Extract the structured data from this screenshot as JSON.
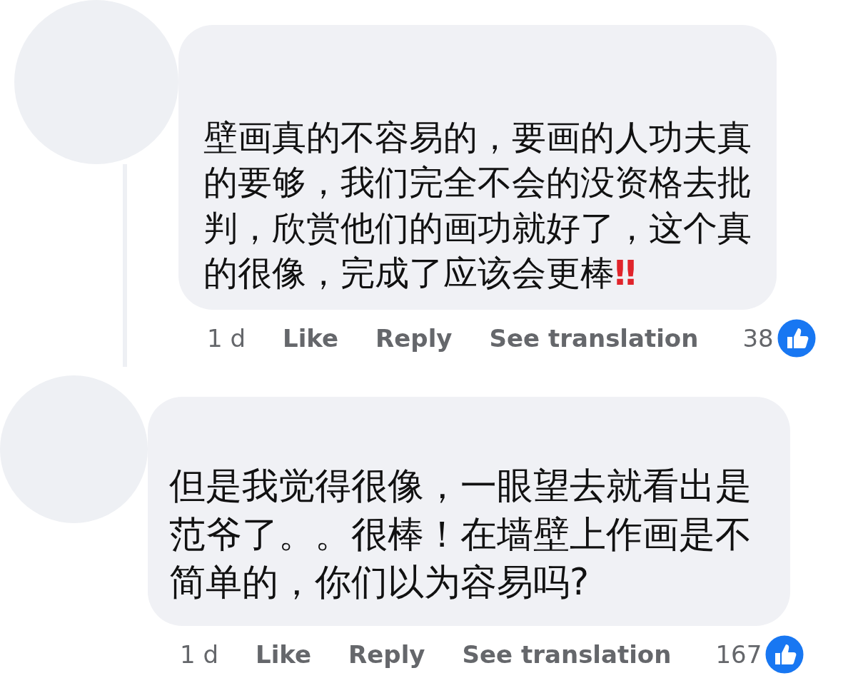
{
  "comments": [
    {
      "text": "壁画真的不容易的，要画的人功夫真的要够，我们完全不会的没资格去批判，欣赏他们的画功就好了，这个真的很像，完成了应该会更棒",
      "emoji": "‼",
      "time": "1 d",
      "like": "Like",
      "reply": "Reply",
      "translate": "See translation",
      "reactions": "38"
    },
    {
      "text": "但是我觉得很像，一眼望去就看出是范爷了。。很棒！在墙壁上作画是不简单的，你们以为容易吗?",
      "time": "1 d",
      "like": "Like",
      "reply": "Reply",
      "translate": "See translation",
      "reactions": "167"
    }
  ]
}
